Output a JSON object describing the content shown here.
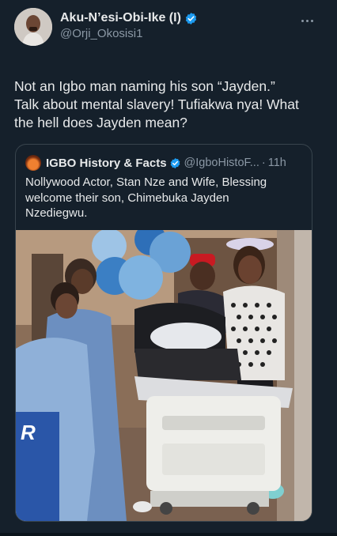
{
  "post": {
    "display_name": "Aku-N’esi-Obi-Ike (I)",
    "handle": "@Orji_Okosisi1",
    "verified": true,
    "more_icon": "more-horizontal-icon",
    "text": "Not an Igbo man naming his son “Jayden.”\nTalk about mental slavery! Tufiakwa nya! What\nthe hell does Jayden mean?"
  },
  "quoted": {
    "display_name": "IGBO History & Facts",
    "handle": "@IgboHistoF...",
    "separator": "·",
    "time": "11h",
    "verified": true,
    "text": "Nollywood Actor, Stan Nze and Wife, Blessing\nwelcome their son, Chimebuka Jayden\nNzediegwu.",
    "media_sign": "R"
  },
  "colors": {
    "background": "#15202b",
    "text_primary": "#e7e9ea",
    "text_secondary": "#8b98a5",
    "verified_blue": "#1d9bf0",
    "border": "#38444d"
  }
}
